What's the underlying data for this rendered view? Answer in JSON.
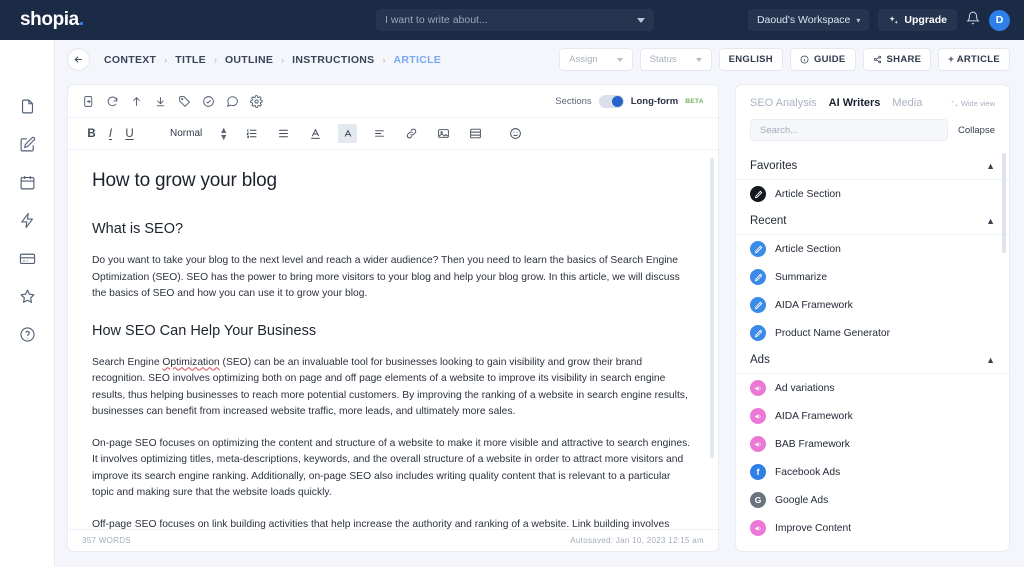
{
  "app": {
    "logo_text": "shopia",
    "logo_dot": "."
  },
  "header": {
    "search_placeholder": "I want to write about...",
    "workspace_label": "Daoud's Workspace",
    "upgrade_label": "Upgrade",
    "avatar_initial": "D",
    "icons": {
      "caret": "chevron-down-icon",
      "bell": "notification-bell-icon",
      "sparkle": "sparkle-icon"
    }
  },
  "rail": {
    "items": [
      {
        "name": "documents-icon"
      },
      {
        "name": "compose-icon"
      },
      {
        "name": "calendar-icon"
      },
      {
        "name": "bolt-icon"
      },
      {
        "name": "billing-icon"
      },
      {
        "name": "star-icon"
      },
      {
        "name": "help-icon"
      }
    ]
  },
  "breadcrumb": {
    "back_label": "←",
    "steps": [
      {
        "label": "CONTEXT",
        "active": false
      },
      {
        "label": "TITLE",
        "active": false
      },
      {
        "label": "OUTLINE",
        "active": false
      },
      {
        "label": "INSTRUCTIONS",
        "active": false
      },
      {
        "label": "ARTICLE",
        "active": true
      }
    ],
    "separator": "›"
  },
  "actions": {
    "assign_label": "Assign",
    "status_label": "Status",
    "language_label": "ENGLISH",
    "guide_label": "GUIDE",
    "share_label": "SHARE",
    "add_article_label": "+ ARTICLE"
  },
  "editor": {
    "tool_icons": [
      "export-icon",
      "refresh-icon",
      "upload-icon",
      "download-icon",
      "tag-icon",
      "check-circle-icon",
      "comment-icon",
      "settings-icon"
    ],
    "sections_label": "Sections",
    "longform_label": "Long-form",
    "beta_label": "BETA",
    "format": {
      "bold": "B",
      "italic": "I",
      "underline": "U",
      "style_label": "Normal"
    },
    "document": {
      "title": "How to grow your blog",
      "blocks": [
        {
          "type": "h2",
          "text": "What is SEO?"
        },
        {
          "type": "p",
          "text": "Do you want to take your blog to the next level and reach a wider audience? Then you need to learn the basics of Search Engine Optimization (SEO). SEO has the power to bring more visitors to your blog and help your blog grow. In this article, we will discuss the basics of SEO and how you can use it to grow your blog."
        },
        {
          "type": "h2",
          "text": "How SEO Can Help Your Business"
        },
        {
          "type": "p_misspell",
          "pre": "Search Engine ",
          "word": "Optimization",
          "post": " (SEO) can be an invaluable tool for businesses looking to gain visibility and grow their brand recognition. SEO involves optimizing both on page and off page elements of a website to improve its visibility in search engine results, thus helping businesses to reach more potential customers. By improving the ranking of a website in search engine results, businesses can benefit from increased website traffic, more leads, and ultimately more sales."
        },
        {
          "type": "p",
          "text": "On-page SEO focuses on optimizing the content and structure of a website to make it more visible and attractive to search engines. It involves optimizing titles, meta-descriptions, keywords, and the overall structure of a website in order to attract more visitors and improve its search engine ranking. Additionally, on-page SEO also includes writing quality content that is relevant to a particular topic and making sure that the website loads quickly."
        },
        {
          "type": "p",
          "text": "Off-page SEO focuses on link building activities that help increase the authority and ranking of a website. Link building involves creating backlinks from other websites in order to drive more traffic to a particular website. This can be done through guest blogging, submitting press releases, directory submissions, participating in forums, etc."
        }
      ]
    },
    "footer": {
      "word_count": "357 WORDS",
      "autosaved": "Autosaved: Jan 10, 2023 12:15 am"
    }
  },
  "panel": {
    "tabs": [
      {
        "label": "SEO Analysis",
        "active": false
      },
      {
        "label": "AI Writers",
        "active": true
      },
      {
        "label": "Media",
        "active": false
      }
    ],
    "wide_view_label": "Wide view",
    "search_placeholder": "Search...",
    "collapse_label": "Collapse",
    "groups": [
      {
        "title": "Favorites",
        "items": [
          {
            "label": "Article Section",
            "icon": "pencil-icon",
            "style": "dark"
          }
        ]
      },
      {
        "title": "Recent",
        "items": [
          {
            "label": "Article Section",
            "icon": "pencil-icon",
            "style": "blue"
          },
          {
            "label": "Summarize",
            "icon": "pencil-icon",
            "style": "blue"
          },
          {
            "label": "AIDA Framework",
            "icon": "pencil-icon",
            "style": "blue"
          },
          {
            "label": "Product Name Generator",
            "icon": "pencil-icon",
            "style": "blue"
          }
        ]
      },
      {
        "title": "Ads",
        "items": [
          {
            "label": "Ad variations",
            "icon": "megaphone-icon",
            "style": "pink"
          },
          {
            "label": "AIDA Framework",
            "icon": "megaphone-icon",
            "style": "pink"
          },
          {
            "label": "BAB Framework",
            "icon": "megaphone-icon",
            "style": "pink"
          },
          {
            "label": "Facebook Ads",
            "icon": "facebook-icon",
            "style": "fb",
            "glyph": "f"
          },
          {
            "label": "Google Ads",
            "icon": "google-icon",
            "style": "g",
            "glyph": "G"
          },
          {
            "label": "Improve Content",
            "icon": "megaphone-icon",
            "style": "pink"
          }
        ]
      }
    ]
  },
  "colors": {
    "header_bg": "#1b2a45",
    "accent": "#3b82f6",
    "active_crumb": "#79a8f0",
    "beta_green": "#6fae5c",
    "spell_error": "#e25563"
  }
}
